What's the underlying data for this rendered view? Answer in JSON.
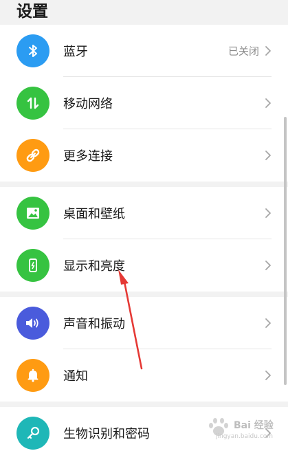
{
  "header": {
    "title": "设置"
  },
  "colors": {
    "bluetooth": "#2b9cf2",
    "mobile": "#36c341",
    "more_connections": "#ff9b12",
    "wallpaper": "#36c341",
    "display": "#36c341",
    "sound": "#4a5bdc",
    "notification": "#ff9b12",
    "biometrics": "#1fb7b7",
    "annotation_arrow": "#e53935"
  },
  "groups": [
    {
      "items": [
        {
          "label": "蓝牙",
          "value": "已关闭",
          "icon": "bluetooth-icon"
        },
        {
          "label": "移动网络",
          "icon": "mobile-data-icon"
        },
        {
          "label": "更多连接",
          "icon": "link-icon"
        }
      ]
    },
    {
      "items": [
        {
          "label": "桌面和壁纸",
          "icon": "image-icon"
        },
        {
          "label": "显示和亮度",
          "icon": "display-brightness-icon"
        }
      ]
    },
    {
      "items": [
        {
          "label": "声音和振动",
          "icon": "speaker-icon"
        },
        {
          "label": "通知",
          "icon": "bell-icon"
        }
      ]
    },
    {
      "items": [
        {
          "label": "生物识别和密码",
          "icon": "key-icon"
        }
      ]
    }
  ],
  "watermark": {
    "brand": "Bai 经验",
    "url": "jingyan.baidu.com"
  }
}
